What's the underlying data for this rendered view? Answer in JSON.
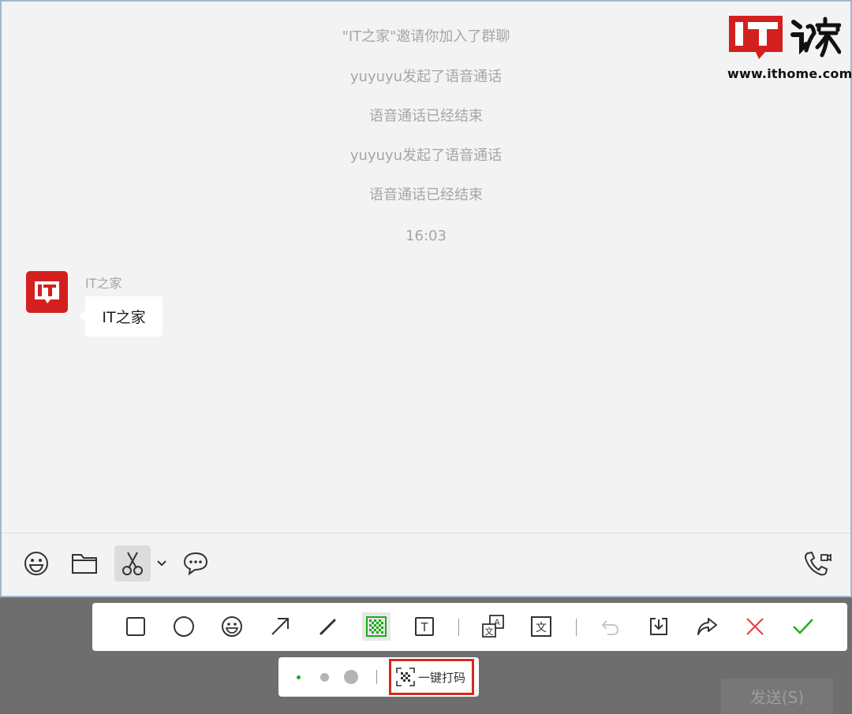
{
  "chat": {
    "system_messages": [
      "\"IT之家\"邀请你加入了群聊",
      "yuyuyu发起了语音通话",
      "语音通话已经结束",
      "yuyuyu发起了语音通话",
      "语音通话已经结束"
    ],
    "timestamp": "16:03",
    "message": {
      "sender": "IT之家",
      "avatar_text": "IT",
      "text": "IT之家"
    }
  },
  "chat_toolbar": {
    "icons": [
      "emoji-icon",
      "folder-icon",
      "scissors-icon",
      "chevron-down-icon",
      "chat-bubble-icon",
      "voice-video-call-icon"
    ]
  },
  "watermark": {
    "logo_text": "IT",
    "url": "www.ithome.com"
  },
  "screenshot_toolbar": {
    "tools": [
      "rectangle-icon",
      "circle-icon",
      "emoji-icon",
      "arrow-icon",
      "pen-icon",
      "mosaic-icon",
      "text-icon",
      "ocr-icon",
      "translate-icon",
      "undo-icon",
      "save-icon",
      "share-icon",
      "cancel-icon",
      "confirm-icon"
    ],
    "text_tool_glyph": "T",
    "translate_glyph": "文",
    "ocr_glyph_a": "A",
    "ocr_glyph_b": "文",
    "colors": {
      "accent": "#1aad19",
      "cancel": "#e64340",
      "disabled": "#c8c8c8"
    }
  },
  "mosaic_options": {
    "sizes": [
      "small",
      "medium",
      "large"
    ],
    "selected_size": "small",
    "one_click_label": "一键打码",
    "highlight_color": "#d5281f"
  },
  "send_button": {
    "label": "发送(S)"
  }
}
